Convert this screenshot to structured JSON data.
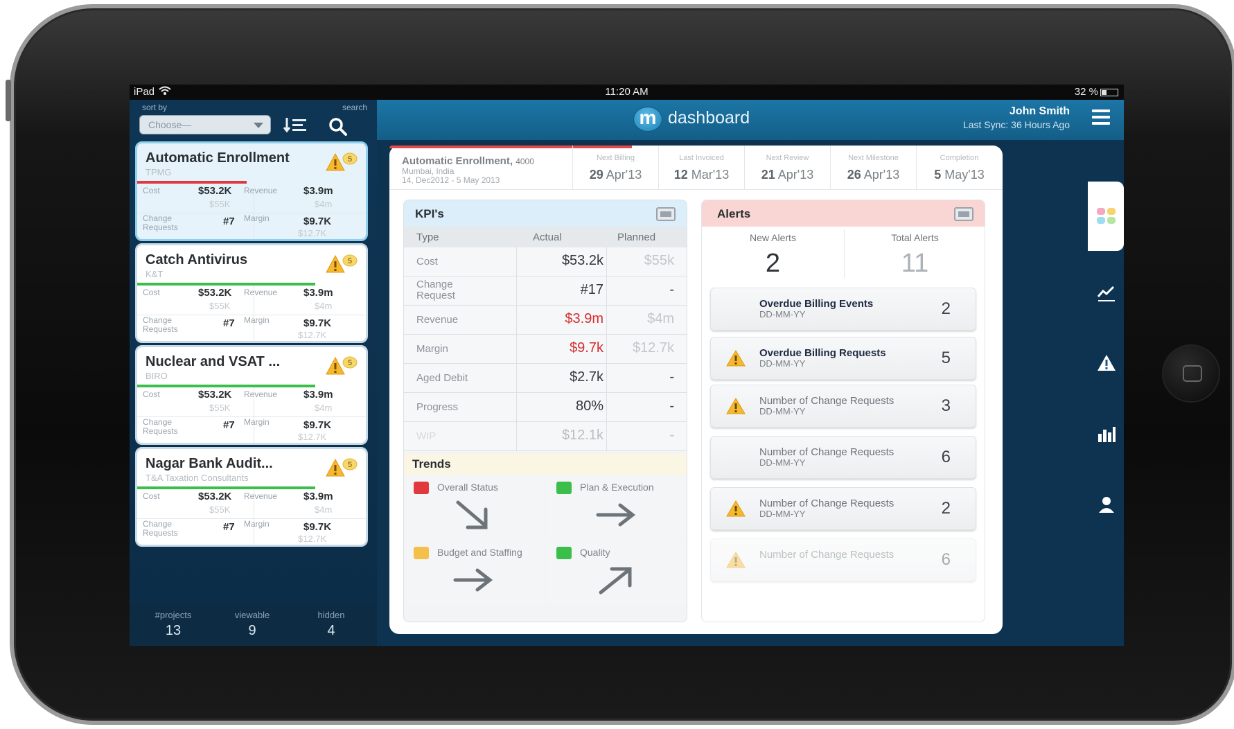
{
  "status_bar": {
    "carrier": "iPad",
    "time": "11:20 AM",
    "battery": "32 %"
  },
  "sidebar": {
    "sort_label": "sort by",
    "search_label": "search",
    "sort_select": {
      "value": "Choose—"
    },
    "projects": [
      {
        "title": "Automatic Enrollment",
        "client": "TPMG",
        "status_color": "#e0393e",
        "cost_label": "Cost",
        "cost": "$53.2K",
        "cost_planned": "$55K",
        "revenue_label": "Revenue",
        "revenue": "$3.9m",
        "revenue_planned": "$4m",
        "cr_label": "Change Requests",
        "cr": "#7",
        "margin_label": "Margin",
        "margin": "$9.7K",
        "margin_planned": "$12.7K",
        "alerts": "5"
      },
      {
        "title": "Catch Antivirus",
        "client": "K&T",
        "status_color": "#3bbf4a",
        "cost_label": "Cost",
        "cost": "$53.2K",
        "cost_planned": "$55K",
        "revenue_label": "Revenue",
        "revenue": "$3.9m",
        "revenue_planned": "$4m",
        "cr_label": "Change Requests",
        "cr": "#7",
        "margin_label": "Margin",
        "margin": "$9.7K",
        "margin_planned": "$12.7K",
        "alerts": "5"
      },
      {
        "title": "Nuclear and VSAT ...",
        "client": "BIRO",
        "status_color": "#3bbf4a",
        "cost_label": "Cost",
        "cost": "$53.2K",
        "cost_planned": "$55K",
        "revenue_label": "Revenue",
        "revenue": "$3.9m",
        "revenue_planned": "$4m",
        "cr_label": "Change Requests",
        "cr": "#7",
        "margin_label": "Margin",
        "margin": "$9.7K",
        "margin_planned": "$12.7K",
        "alerts": "5"
      },
      {
        "title": "Nagar Bank Audit...",
        "client": "T&A Taxation Consultants",
        "status_color": "#3bbf4a",
        "cost_label": "Cost",
        "cost": "$53.2K",
        "cost_planned": "$55K",
        "revenue_label": "Revenue",
        "revenue": "$3.9m",
        "revenue_planned": "$4m",
        "cr_label": "Change Requests",
        "cr": "#7",
        "margin_label": "Margin",
        "margin": "$9.7K",
        "margin_planned": "$12.7K",
        "alerts": "5"
      }
    ],
    "stats": [
      {
        "label": "#projects",
        "value": "13"
      },
      {
        "label": "viewable",
        "value": "9"
      },
      {
        "label": "hidden",
        "value": "4"
      }
    ]
  },
  "header": {
    "logo_letter": "m",
    "title": "dashboard",
    "user": "John Smith",
    "sync": "Last Sync: 36 Hours Ago"
  },
  "project": {
    "name": "Automatic Enrollment,",
    "code": "4000",
    "location": "Mumbai, India",
    "dates": "14, Dec2012 - 5 May 2013",
    "milestones": [
      {
        "label": "Next Billing",
        "day": "29",
        "rest": "Apr'13"
      },
      {
        "label": "Last Invoiced",
        "day": "12",
        "rest": "Mar'13"
      },
      {
        "label": "Next Review",
        "day": "21",
        "rest": "Apr'13"
      },
      {
        "label": "Next Milestone",
        "day": "26",
        "rest": "Apr'13"
      },
      {
        "label": "Completion",
        "day": "5",
        "rest": "May'13"
      }
    ]
  },
  "kpis": {
    "title": "KPI's",
    "columns": [
      "Type",
      "Actual",
      "Planned"
    ],
    "rows": [
      {
        "type": "Cost",
        "actual": "$53.2k",
        "planned": "$55k"
      },
      {
        "type": "Change Request",
        "actual": "#17",
        "planned": "-"
      },
      {
        "type": "Revenue",
        "actual": "$3.9m",
        "planned": "$4m"
      },
      {
        "type": "Margin",
        "actual": "$9.7k",
        "planned": "$12.7k"
      },
      {
        "type": "Aged Debit",
        "actual": "$2.7k",
        "planned": "-"
      },
      {
        "type": "Progress",
        "actual": "80%",
        "planned": "-"
      },
      {
        "type": "WIP",
        "actual": "$12.1k",
        "planned": "-"
      }
    ],
    "trends_title": "Trends",
    "trends": [
      {
        "label": "Overall Status",
        "color": "#e0393e",
        "direction": "down-right"
      },
      {
        "label": "Plan & Execution",
        "color": "#3bbf4a",
        "direction": "right"
      },
      {
        "label": "Budget and Staffing",
        "color": "#f5c04a",
        "direction": "right"
      },
      {
        "label": "Quality",
        "color": "#3bbf4a",
        "direction": "up-right"
      }
    ]
  },
  "alerts": {
    "title": "Alerts",
    "new_label": "New Alerts",
    "new_count": "2",
    "total_label": "Total Alerts",
    "total_count": "11",
    "items": [
      {
        "title": "Overdue Billing Events",
        "date": "DD-MM-YY",
        "count": "2",
        "warning": false,
        "new": true
      },
      {
        "title": "Overdue Billing Requests",
        "date": "DD-MM-YY",
        "count": "5",
        "warning": true,
        "new": true
      },
      {
        "title": "Number of Change Requests",
        "date": "DD-MM-YY",
        "count": "3",
        "warning": true,
        "new": false
      },
      {
        "title": "Number of Change Requests",
        "date": "DD-MM-YY",
        "count": "6",
        "warning": false,
        "new": false
      },
      {
        "title": "Number of Change Requests",
        "date": "DD-MM-YY",
        "count": "2",
        "warning": true,
        "new": false
      },
      {
        "title": "Number of Change Requests",
        "date": "",
        "count": "6",
        "warning": true,
        "new": false
      }
    ]
  },
  "right_nav": [
    "tiles-icon",
    "trend-line-icon",
    "warning-icon",
    "bar-chart-icon",
    "person-icon"
  ],
  "colors": {
    "accent": "#1c76a6",
    "alert_red": "#e0393e",
    "ok_green": "#3bbf4a",
    "warn_yellow": "#f5b82e"
  }
}
